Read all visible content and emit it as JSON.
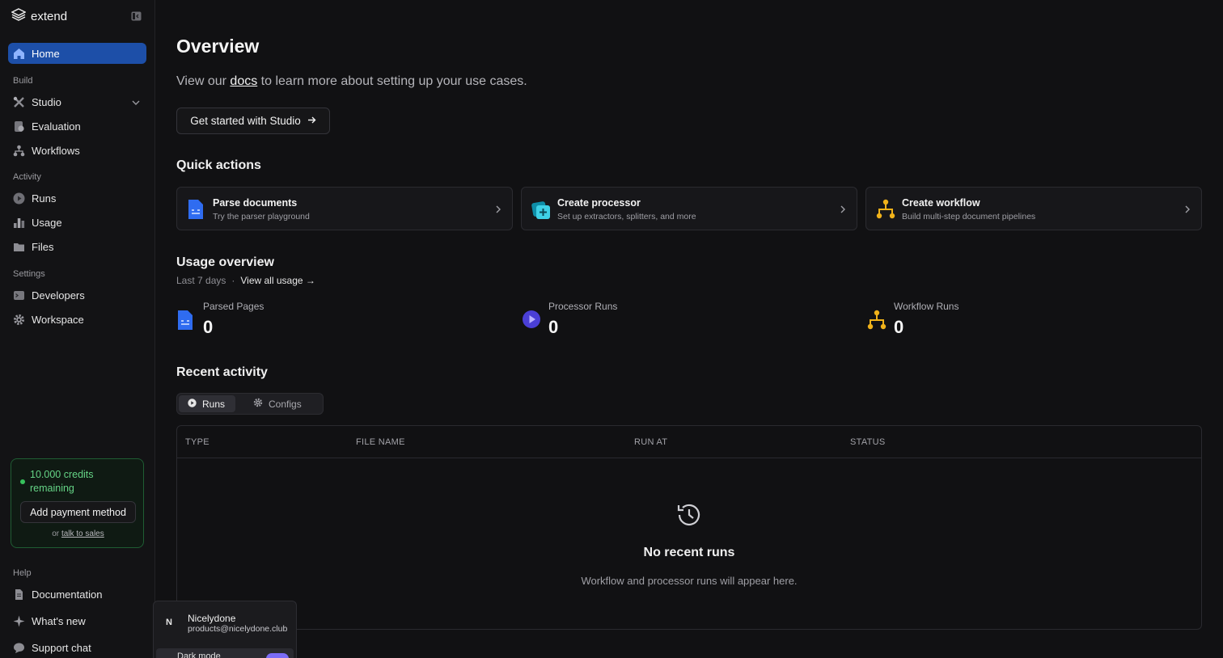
{
  "brand": {
    "name": "extend"
  },
  "sidebar": {
    "home": "Home",
    "sections": {
      "build": "Build",
      "activity": "Activity",
      "settings": "Settings",
      "help": "Help"
    },
    "build_items": [
      "Studio",
      "Evaluation",
      "Workflows"
    ],
    "activity_items": [
      "Runs",
      "Usage",
      "Files"
    ],
    "settings_items": [
      "Developers",
      "Workspace"
    ],
    "help_items": [
      "Documentation",
      "What's new",
      "Support chat"
    ],
    "credits": {
      "text": "10.000 credits remaining",
      "button": "Add payment method",
      "or": "or",
      "sales_link": "talk to sales"
    }
  },
  "main": {
    "title": "Overview",
    "subtitle_pre": "View our",
    "subtitle_link": "docs",
    "subtitle_post": "to learn more about setting up your use cases.",
    "studio_button": "Get started with Studio",
    "quick_actions": {
      "heading": "Quick actions",
      "cards": [
        {
          "title": "Parse documents",
          "desc": "Try the parser playground"
        },
        {
          "title": "Create processor",
          "desc": "Set up extractors, splitters, and more"
        },
        {
          "title": "Create workflow",
          "desc": "Build multi-step document pipelines"
        }
      ]
    },
    "usage": {
      "heading": "Usage overview",
      "period": "Last 7 days",
      "separator": "·",
      "view_all": "View all usage →",
      "stats": [
        {
          "label": "Parsed Pages",
          "value": "0"
        },
        {
          "label": "Processor Runs",
          "value": "0"
        },
        {
          "label": "Workflow Runs",
          "value": "0"
        }
      ]
    },
    "recent": {
      "heading": "Recent activity",
      "tabs": [
        "Runs",
        "Configs"
      ],
      "columns": [
        "TYPE",
        "FILE NAME",
        "RUN AT",
        "STATUS"
      ],
      "empty_title": "No recent runs",
      "empty_desc": "Workflow and processor runs will appear here."
    }
  },
  "user": {
    "initial": "N",
    "name": "Nicelydone",
    "email": "products@nicelydone.club",
    "theme_label": "Dark mode"
  },
  "colors": {
    "accent": "#1d4fa8",
    "credits_green": "#37c25c",
    "toggle": "#7b6cf6"
  }
}
